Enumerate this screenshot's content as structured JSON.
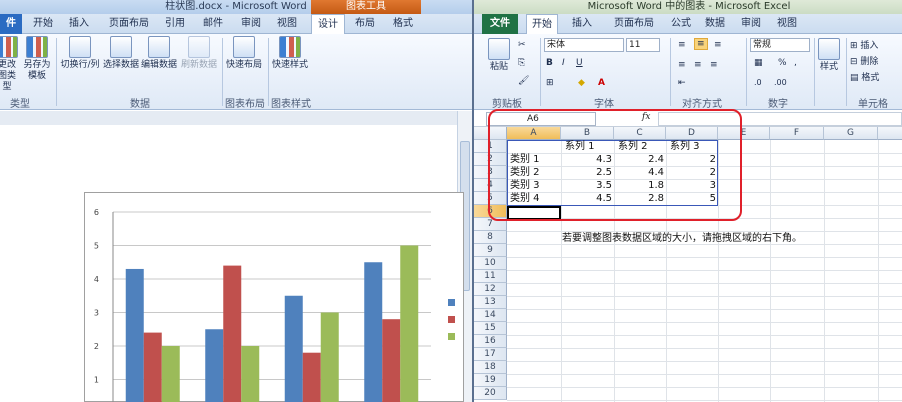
{
  "word": {
    "title": "柱状图.docx - Microsoft Word",
    "context_tab": "图表工具",
    "tabs": [
      "件",
      "开始",
      "插入",
      "页面布局",
      "引用",
      "邮件",
      "审阅",
      "视图",
      "设计",
      "布局",
      "格式"
    ],
    "ribbon": {
      "buttons": [
        {
          "label": "更改\n图类型"
        },
        {
          "label": "另存为\n模板"
        },
        {
          "label": "切换行/列"
        },
        {
          "label": "选择数据"
        },
        {
          "label": "编辑数据"
        },
        {
          "label": "刷新数据"
        },
        {
          "label": "快速布局"
        },
        {
          "label": "快速样式"
        }
      ],
      "groups": [
        "类型",
        "数据",
        "图表布局",
        "图表样式"
      ]
    },
    "chart": {
      "y_ticks": [
        "6",
        "5",
        "4",
        "3",
        "2",
        "1"
      ]
    }
  },
  "chart_data": {
    "type": "bar",
    "categories": [
      "类别 1",
      "类别 2",
      "类别 3",
      "类别 4"
    ],
    "series": [
      {
        "name": "系列 1",
        "values": [
          4.3,
          2.5,
          3.5,
          4.5
        ],
        "color": "#4f81bd"
      },
      {
        "name": "系列 2",
        "values": [
          2.4,
          4.4,
          1.8,
          2.8
        ],
        "color": "#c0504d"
      },
      {
        "name": "系列 3",
        "values": [
          2,
          2,
          3,
          5
        ],
        "color": "#9bbb59"
      }
    ],
    "ylim": [
      0,
      6
    ],
    "grid": true,
    "legend": "right"
  },
  "excel": {
    "title": "Microsoft Word 中的图表 - Microsoft Excel",
    "tabs": [
      "文件",
      "开始",
      "插入",
      "页面布局",
      "公式",
      "数据",
      "审阅",
      "视图"
    ],
    "ribbon": {
      "paste": "粘贴",
      "font_name": "宋体",
      "font_size": "11",
      "number_format": "常规",
      "styles": "样式",
      "insert": "插入",
      "delete": "删除",
      "format": "格式",
      "groups": [
        "剪贴板",
        "字体",
        "对齐方式",
        "数字",
        "单元格"
      ]
    },
    "name_box": "A6",
    "fx": "fx",
    "columns": [
      "A",
      "B",
      "C",
      "D",
      "E",
      "F",
      "G"
    ],
    "rows": [
      "1",
      "2",
      "3",
      "4",
      "5",
      "6",
      "7",
      "8",
      "9",
      "10",
      "11",
      "12",
      "13",
      "14",
      "15",
      "16",
      "17",
      "18",
      "19",
      "20"
    ],
    "header_row": [
      "",
      "系列 1",
      "系列 2",
      "系列 3"
    ],
    "data_rows": [
      [
        "类别 1",
        "4.3",
        "2.4",
        "2"
      ],
      [
        "类别 2",
        "2.5",
        "4.4",
        "2"
      ],
      [
        "类别 3",
        "3.5",
        "1.8",
        "3"
      ],
      [
        "类别 4",
        "4.5",
        "2.8",
        "5"
      ]
    ],
    "note": "若要调整图表数据区域的大小，请拖拽区域的右下角。"
  }
}
